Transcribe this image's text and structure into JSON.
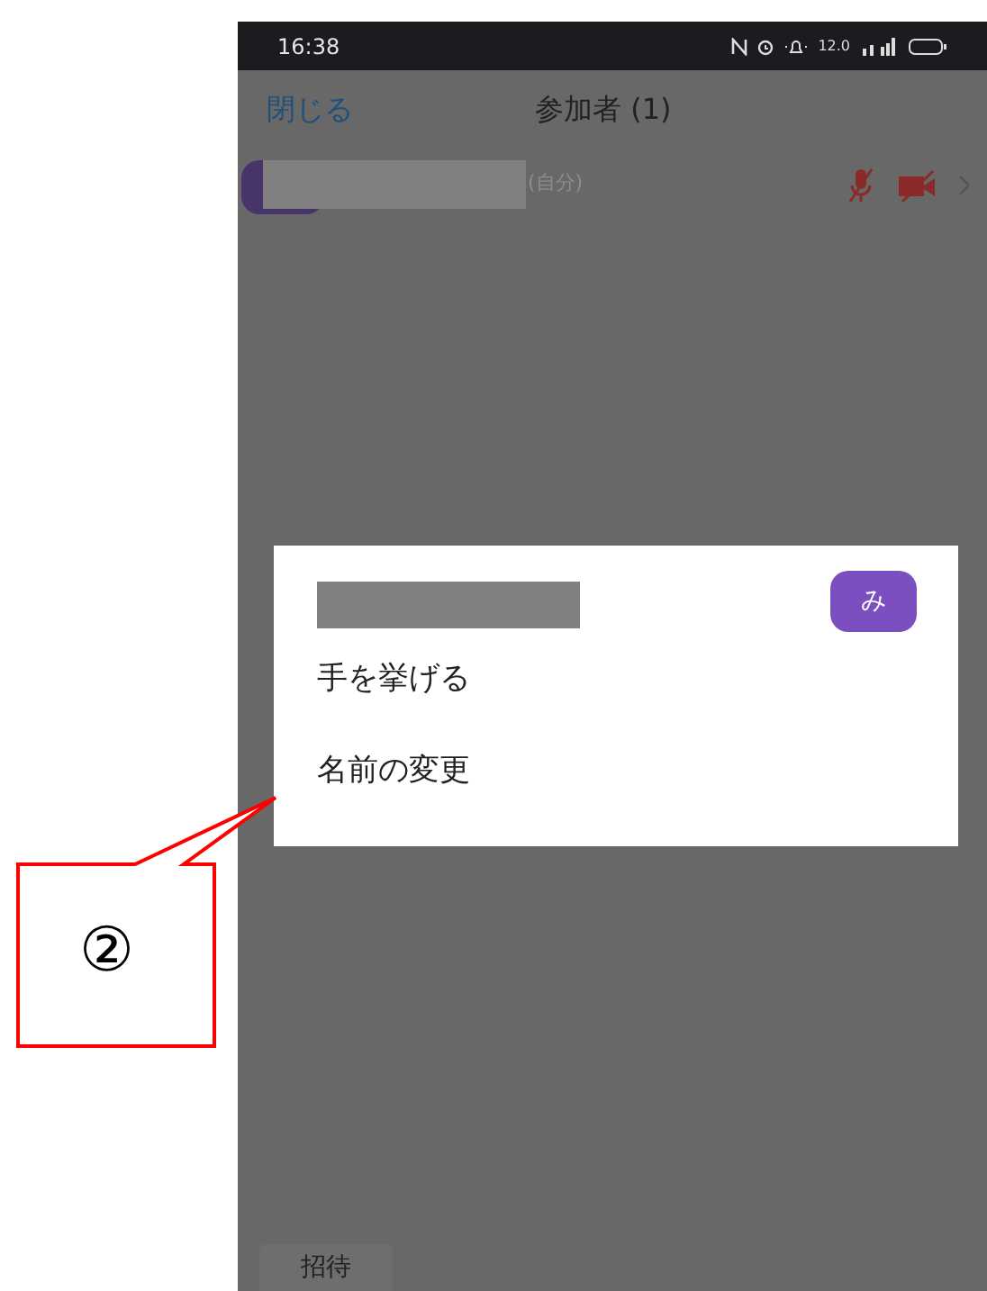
{
  "status_bar": {
    "time": "16:38",
    "speed": "12.0"
  },
  "header": {
    "close": "閉じる",
    "title": "参加者 (1)"
  },
  "participants": [
    {
      "suffix": "(自分)",
      "muted": true,
      "video_off": true
    }
  ],
  "popup": {
    "avatar_initial": "み",
    "items": [
      "手を挙げる",
      "名前の変更"
    ]
  },
  "invite": "招待",
  "callout": {
    "label": "②"
  }
}
